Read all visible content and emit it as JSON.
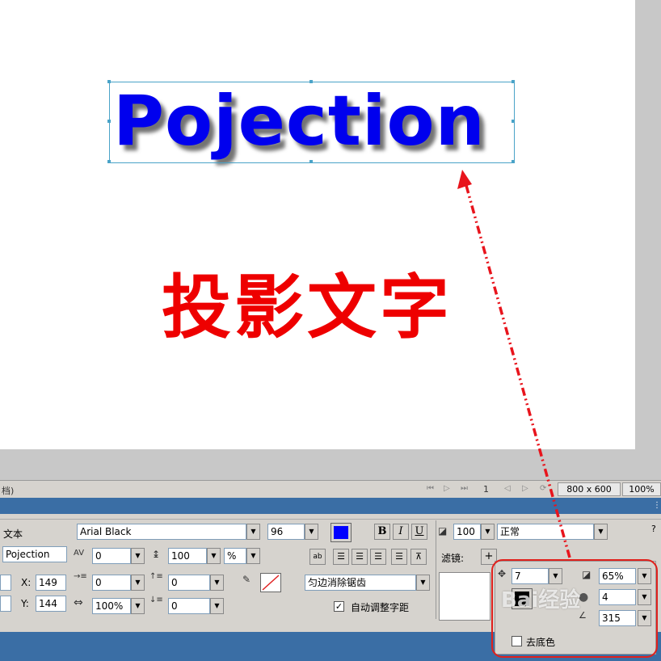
{
  "canvas": {
    "main_text": "Pojection",
    "caption": "投影文字"
  },
  "status": {
    "left_text": "档)",
    "page_number": "1",
    "canvas_size": "800 x 600",
    "zoom": "100%"
  },
  "properties": {
    "type_label": "文本",
    "element_name": "Pojection",
    "x_label": "X:",
    "x_value": "149",
    "y_label": "Y:",
    "y_value": "144",
    "font": "Arial Black",
    "font_size": "96",
    "text_color": "#0000ff",
    "bold_label": "B",
    "italic_label": "I",
    "underline_label": "U",
    "kerning": "0",
    "leading": "100",
    "leading_unit": "%",
    "indent": "0",
    "space_before": "0",
    "horizontal_scale": "100%",
    "space_after": "0",
    "antialias": "匀边消除锯齿",
    "auto_kern_label": "自动调整字距",
    "auto_kern_checked": true,
    "opacity": "100",
    "blend_mode": "正常",
    "filters_label": "滤镜:",
    "add_filter_label": "+",
    "help_label": "?"
  },
  "shadow_popup": {
    "distance": "7",
    "opacity": "65%",
    "softness": "4",
    "angle": "315",
    "color": "#000000",
    "knockout_label": "去底色"
  },
  "watermark": "Bai经验"
}
